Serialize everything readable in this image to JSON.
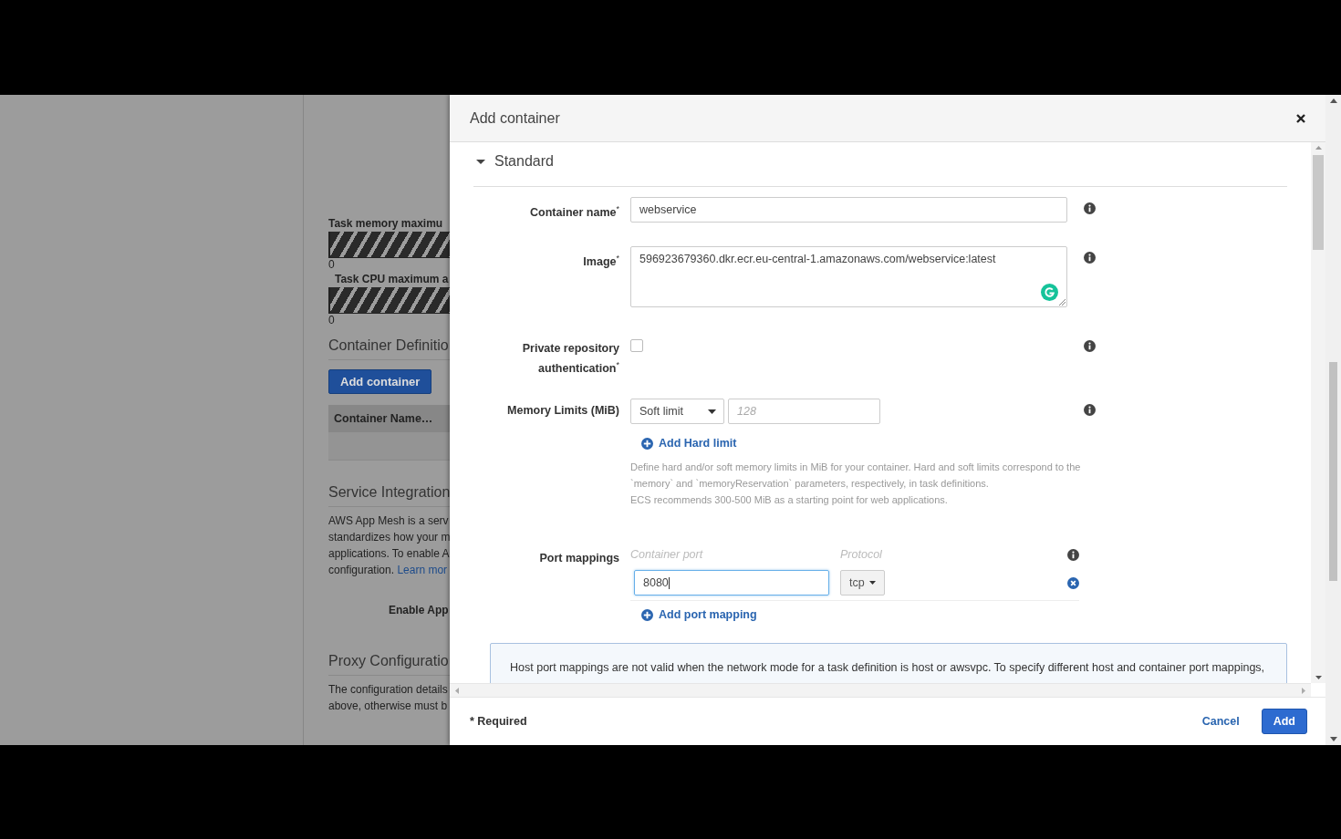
{
  "background_page": {
    "memory_label": "Task memory maximu",
    "memory_min": "0",
    "cpu_label": "Task CPU maximum a",
    "cpu_min": "0",
    "definitions_heading": "Container Definitio",
    "add_container_button": "Add container",
    "table_columns": [
      "Container Name…"
    ],
    "service_heading": "Service Integration",
    "service_lines": [
      "AWS App Mesh is a serv",
      "standardizes how your m",
      "applications. To enable A"
    ],
    "service_last_line": "configuration.",
    "learn_more_link": "Learn mor",
    "enable_label": "Enable App",
    "proxy_heading": "Proxy Configuratio",
    "proxy_lines": [
      "The configuration details",
      "above, otherwise must b"
    ]
  },
  "dialog": {
    "title": "Add container",
    "section": {
      "title": "Standard",
      "expanded": true
    },
    "fields": [
      {
        "kind": "text",
        "label": "Container name$^{*}$",
        "value": "webservice"
      },
      {
        "kind": "textarea",
        "label": "Image$^{*}$",
        "value": "596923679360.dkr.ecr.eu-central-1.amazonaws.com/webservice:latest"
      },
      {
        "kind": "checkbox",
        "label": "Private repository authentication$^{*}$",
        "checked": false
      },
      {
        "kind": "memory",
        "label": "Memory Limits (MiB)",
        "select": "Soft limit",
        "placeholder": "128",
        "add_link": "Add Hard limit",
        "help_lines": [
          "Define hard and/or soft memory limits in MiB for your container. Hard and soft limits correspond to the",
          "`memory` and `memoryReservation` parameters, respectively, in task definitions.",
          "ECS recommends 300-500 MiB as a starting point for web applications."
        ]
      },
      {
        "kind": "ports",
        "label": "Port mappings",
        "column_1": "Container port",
        "column_2": "Protocol",
        "rows": [
          {
            "port": "8080",
            "protocol": "tcp"
          }
        ],
        "add_link": "Add port mapping"
      }
    ],
    "notice": "Host port mappings are not valid when the network mode for a task definition is host or awsvpc. To specify different host and container port mappings,",
    "footer": {
      "required_note": "* Required",
      "cancel": "Cancel",
      "add": "Add"
    }
  }
}
